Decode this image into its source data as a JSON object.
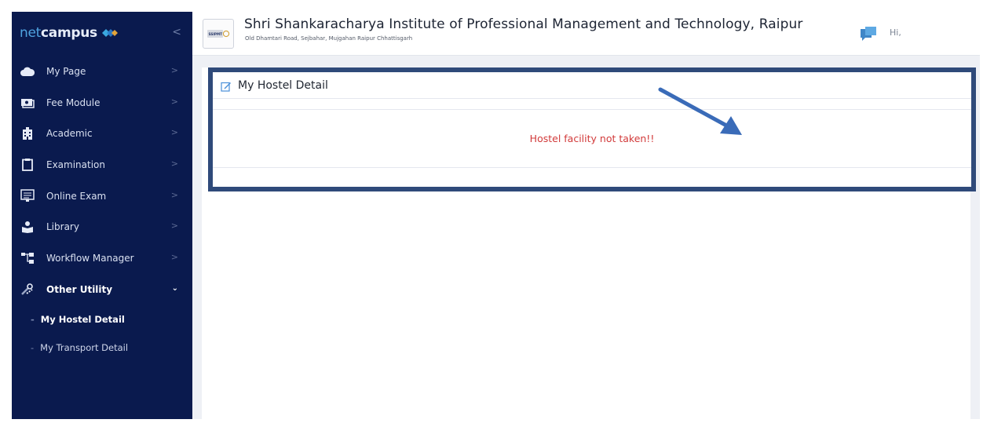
{
  "brand": {
    "prefix": "net",
    "name": "campus"
  },
  "sidebar": {
    "items": [
      {
        "label": "My Page",
        "icon": "cloud-icon"
      },
      {
        "label": "Fee Module",
        "icon": "money-icon"
      },
      {
        "label": "Academic",
        "icon": "building-icon"
      },
      {
        "label": "Examination",
        "icon": "clipboard-icon"
      },
      {
        "label": "Online Exam",
        "icon": "monitor-icon"
      },
      {
        "label": "Library",
        "icon": "reader-icon"
      },
      {
        "label": "Workflow Manager",
        "icon": "sitemap-icon"
      },
      {
        "label": "Other Utility",
        "icon": "tools-icon"
      }
    ],
    "submenu": [
      {
        "label": "My Hostel Detail"
      },
      {
        "label": "My Transport Detail"
      }
    ]
  },
  "header": {
    "institute": "Shri Shankaracharya Institute of Professional Management and Technology, Raipur",
    "address": "Old Dhamtari Road, Sejbahar, Mujgahan Raipur Chhattisgarh",
    "greeting": "Hi,",
    "logo_text": "SSIPMT"
  },
  "card": {
    "title": "My Hostel Detail",
    "message": "Hostel facility not taken!!"
  },
  "colors": {
    "sidebar_bg": "#0a1a4e",
    "highlight_border": "#2f4a7a",
    "notice_red": "#d23a3a",
    "arrow_blue": "#3a6bb8"
  }
}
